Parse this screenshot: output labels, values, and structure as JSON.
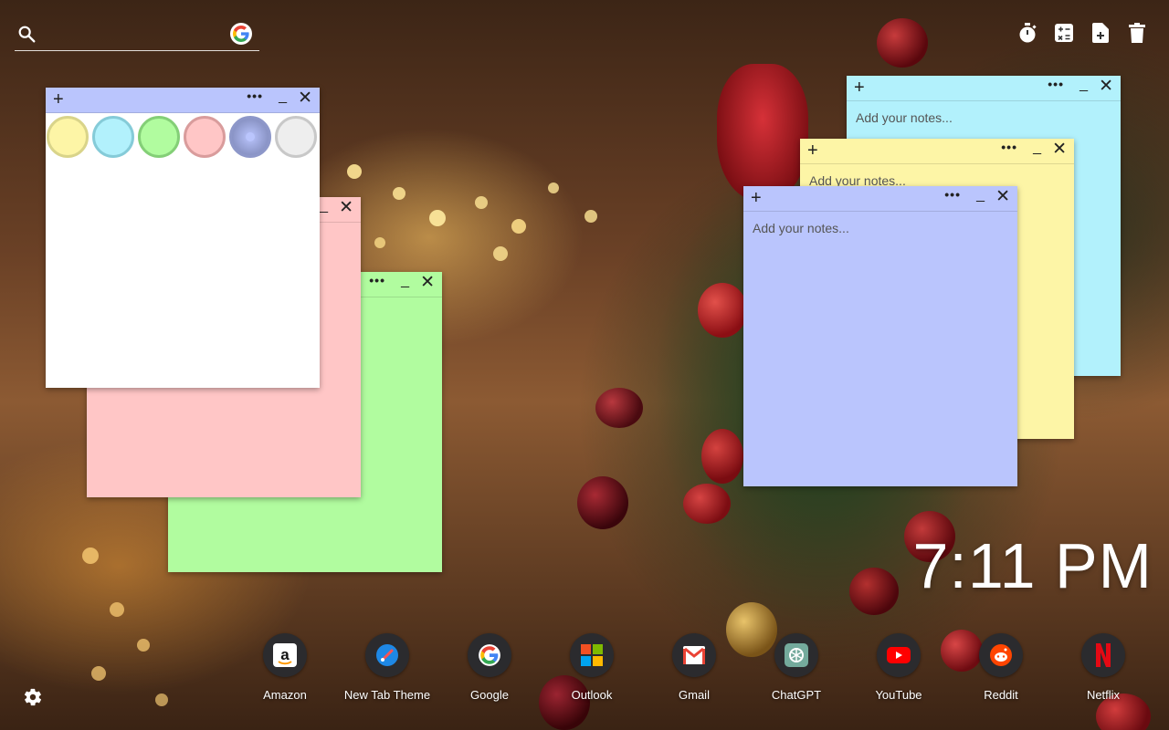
{
  "search": {
    "placeholder": "",
    "icon": "search-icon",
    "engine_icon": "google-icon"
  },
  "toolbar": {
    "items": [
      {
        "name": "timer",
        "icon": "stopwatch-icon"
      },
      {
        "name": "calculator",
        "icon": "calculator-icon"
      },
      {
        "name": "new-note",
        "icon": "add-note-icon"
      },
      {
        "name": "delete",
        "icon": "trash-icon"
      }
    ]
  },
  "notes": [
    {
      "id": "white",
      "color": "#ffffff",
      "placeholder": "",
      "showing_palette": true
    },
    {
      "id": "pink",
      "color": "#ffc6c6",
      "placeholder": ""
    },
    {
      "id": "green",
      "color": "#b1fc9f",
      "placeholder": ""
    },
    {
      "id": "cyan",
      "color": "#b2f1fc",
      "placeholder": "Add your notes..."
    },
    {
      "id": "yellow",
      "color": "#fdf5a6",
      "placeholder": "Add your notes..."
    },
    {
      "id": "blue",
      "color": "#bac5fd",
      "placeholder": "Add your notes..."
    }
  ],
  "note_controls": {
    "add": "+",
    "more": "•••",
    "minimize": "_",
    "close": "✕"
  },
  "palette": {
    "swatches": [
      {
        "name": "yellow",
        "color": "#fdf5a6",
        "ring": "#d9d48a"
      },
      {
        "name": "cyan",
        "color": "#b2f1fc",
        "ring": "#85cbd8"
      },
      {
        "name": "green",
        "color": "#b1fc9f",
        "ring": "#84cf77"
      },
      {
        "name": "pink",
        "color": "#ffc6c6",
        "ring": "#d99c9c"
      },
      {
        "name": "blue",
        "color": "#bac5fd",
        "ring": "#8d97c9",
        "selected": true
      },
      {
        "name": "white",
        "color": "#eeeeee",
        "ring": "#c8c8c8"
      }
    ]
  },
  "clock": {
    "time": "7:11 PM"
  },
  "shortcuts": [
    {
      "label": "Amazon",
      "icon": "amazon-icon"
    },
    {
      "label": "New Tab Theme",
      "icon": "new-tab-theme-icon"
    },
    {
      "label": "Google",
      "icon": "google-icon"
    },
    {
      "label": "Outlook",
      "icon": "microsoft-icon"
    },
    {
      "label": "Gmail",
      "icon": "gmail-icon"
    },
    {
      "label": "ChatGPT",
      "icon": "chatgpt-icon"
    },
    {
      "label": "YouTube",
      "icon": "youtube-icon"
    },
    {
      "label": "Reddit",
      "icon": "reddit-icon"
    },
    {
      "label": "Netflix",
      "icon": "netflix-icon"
    }
  ],
  "settings": {
    "icon": "gear-icon"
  }
}
